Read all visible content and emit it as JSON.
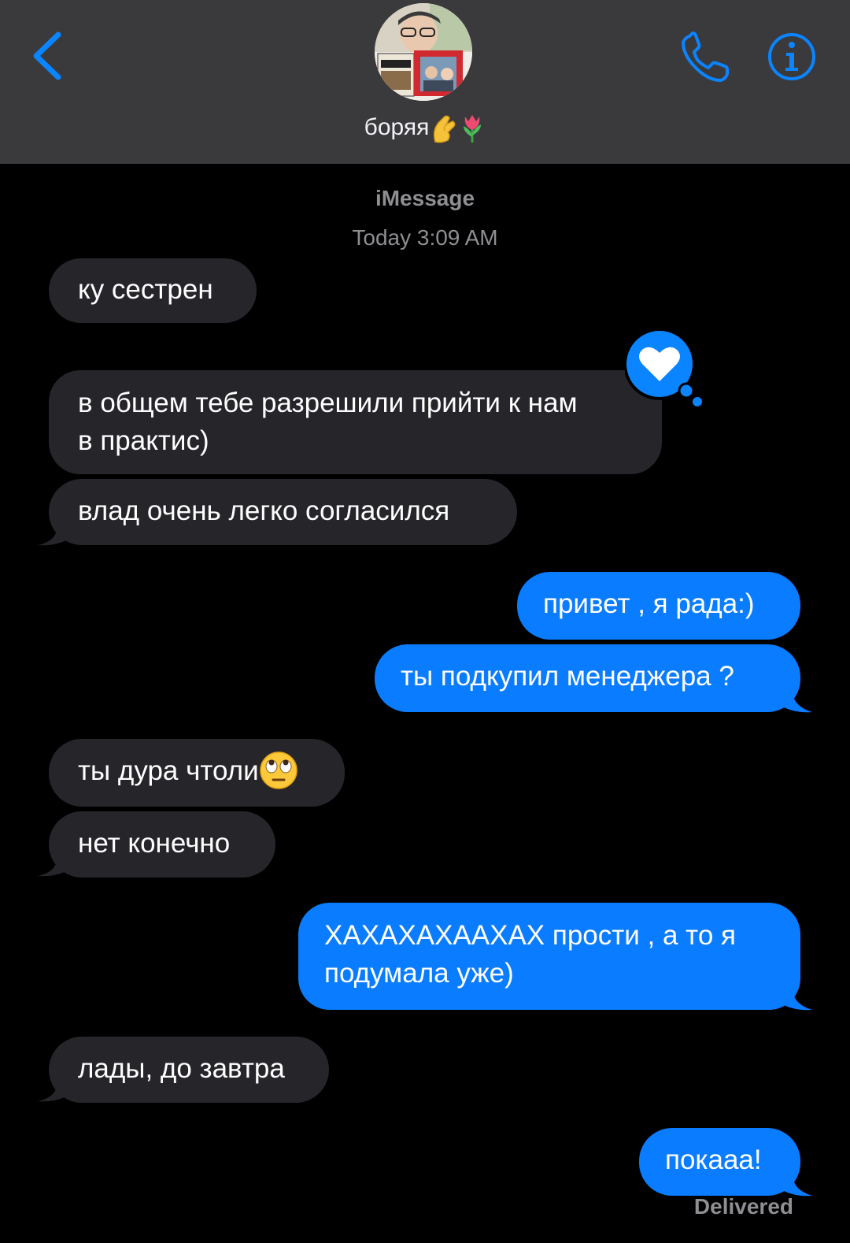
{
  "header": {
    "contact_name": "боряя",
    "name_emojis": [
      "pinching-hand-emoji",
      "tulip-emoji"
    ],
    "back_icon": "chevron-left-icon",
    "call_icon": "phone-icon",
    "info_icon": "info-icon",
    "background": "#3a3a3c",
    "accent": "#0a84ff"
  },
  "thread": {
    "service": "iMessage",
    "timestamp": "Today 3:09 AM",
    "delivered": "Delivered"
  },
  "messages": [
    {
      "id": "m1",
      "from": "them",
      "text": "ку сестрен"
    },
    {
      "id": "m2",
      "from": "them",
      "lines": [
        "в общем тебе разрешили прийти к нам",
        "в практис)"
      ],
      "reaction": "heart"
    },
    {
      "id": "m3",
      "from": "them",
      "text": "влад очень легко согласился"
    },
    {
      "id": "m4",
      "from": "me",
      "text": "привет , я рада:)"
    },
    {
      "id": "m5",
      "from": "me",
      "text": "ты подкупил менеджера ?"
    },
    {
      "id": "m6",
      "from": "them",
      "text": "ты дура чтоли",
      "emoji": "face-with-rolling-eyes-emoji"
    },
    {
      "id": "m7",
      "from": "them",
      "text": "нет конечно"
    },
    {
      "id": "m8",
      "from": "me",
      "lines": [
        "ХАХАХАХААХАХ прости , а то я",
        "подумала уже)"
      ]
    },
    {
      "id": "m9",
      "from": "them",
      "text": "лады, до завтра"
    },
    {
      "id": "m10",
      "from": "me",
      "text": "покааа!"
    }
  ],
  "colors": {
    "incoming_bubble": "#26252a",
    "outgoing_bubble": "#0a7cff",
    "meta_text": "#8e8e93"
  }
}
